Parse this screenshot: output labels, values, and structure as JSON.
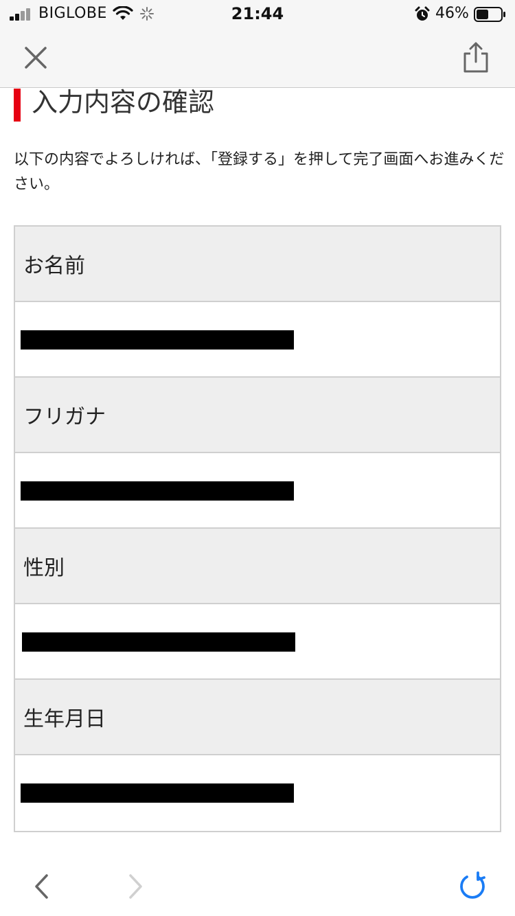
{
  "status_bar": {
    "carrier": "BIGLOBE",
    "time": "21:44",
    "battery_percent": "46%",
    "icons": [
      "signal-icon",
      "wifi-icon",
      "activity-icon",
      "alarm-icon",
      "battery-icon"
    ]
  },
  "browser": {
    "close_icon": "close-icon",
    "share_icon": "share-icon",
    "back_icon": "chevron-left-icon",
    "forward_icon": "chevron-right-icon",
    "reload_icon": "reload-icon",
    "reload_color": "#1a7cf5"
  },
  "page": {
    "heading": "入力内容の確認",
    "heading_accent_color": "#e60012",
    "intro": "以下の内容でよろしければ、「登録する」を押して完了画面へお進みください。"
  },
  "form": {
    "fields": [
      {
        "label": "お名前"
      },
      {
        "label": "フリガナ"
      },
      {
        "label": "性別"
      },
      {
        "label": "生年月日"
      }
    ]
  }
}
